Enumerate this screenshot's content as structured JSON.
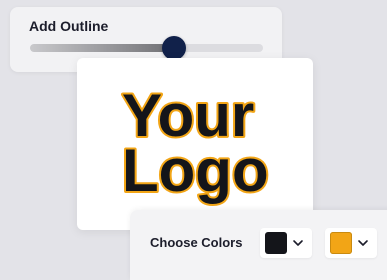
{
  "outline": {
    "title": "Add Outline",
    "value_fraction": 0.62
  },
  "logo": {
    "line1": "Your",
    "line2": "Logo",
    "fill_color": "#14151a",
    "outline_color": "#f2a516"
  },
  "colors": {
    "label": "Choose Colors",
    "primary": {
      "color": "#14151a",
      "icon": "chevron-down-icon"
    },
    "secondary": {
      "color": "#f2a516",
      "icon": "chevron-down-icon"
    }
  },
  "theme": {
    "slider_thumb": "#11214a",
    "background": "#e3e3e8"
  }
}
